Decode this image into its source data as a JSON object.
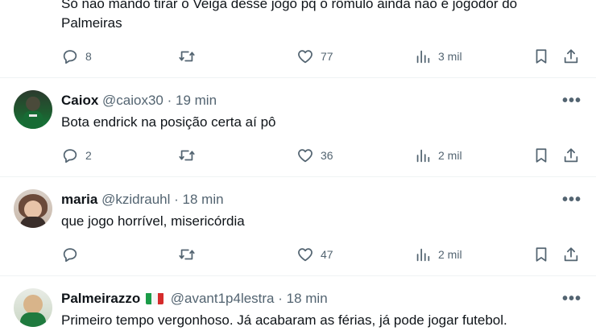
{
  "tweets": [
    {
      "text_line1": "Só não mando tirar o Veiga desse jogo pq o rômulo ainda não é jogodor do",
      "text_line2": "Palmeiras",
      "replies": "8",
      "retweets": "",
      "likes": "77",
      "views": "3 mil"
    },
    {
      "name": "Caiox",
      "handle": "@caiox30",
      "time": "· 19 min",
      "text": "Bota endrick na posição certa aí pô",
      "replies": "2",
      "retweets": "",
      "likes": "36",
      "views": "2 mil"
    },
    {
      "name": "maria",
      "handle": "@kzidrauhl",
      "time": "· 18 min",
      "text": "que jogo horrível, misericórdia",
      "replies": "",
      "retweets": "",
      "likes": "47",
      "views": "2 mil"
    },
    {
      "name": "Palmeirazzo",
      "handle": "@avant1p4lestra",
      "time": "· 18 min",
      "text": "Primeiro tempo vergonhoso. Já acabaram as férias, já pode jogar futebol."
    }
  ],
  "more_label": "•••",
  "colors": {
    "text": "#0f1419",
    "secondary": "#536471",
    "divider": "#eff3f4"
  },
  "icons": [
    "reply-icon",
    "retweet-icon",
    "like-icon",
    "views-icon",
    "bookmark-icon",
    "share-icon",
    "more-icon",
    "italy-flag-icon"
  ]
}
